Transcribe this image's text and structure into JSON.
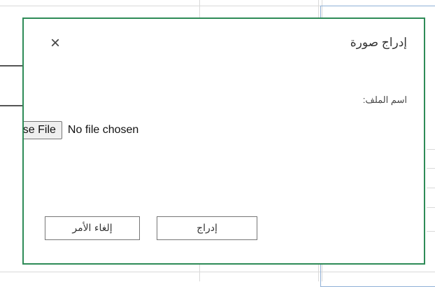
{
  "dialog": {
    "title": "إدراج صورة",
    "close_icon": "×",
    "file_label": "اسم الملف:",
    "file_button_label": "oose File",
    "file_status": "No file chosen",
    "insert_label": "إدراج",
    "cancel_label": "إلغاء الأمر"
  },
  "colors": {
    "dialog_border": "#2e8b57",
    "grid_line": "#d9d9d9",
    "selection": "#8fb0d6"
  }
}
